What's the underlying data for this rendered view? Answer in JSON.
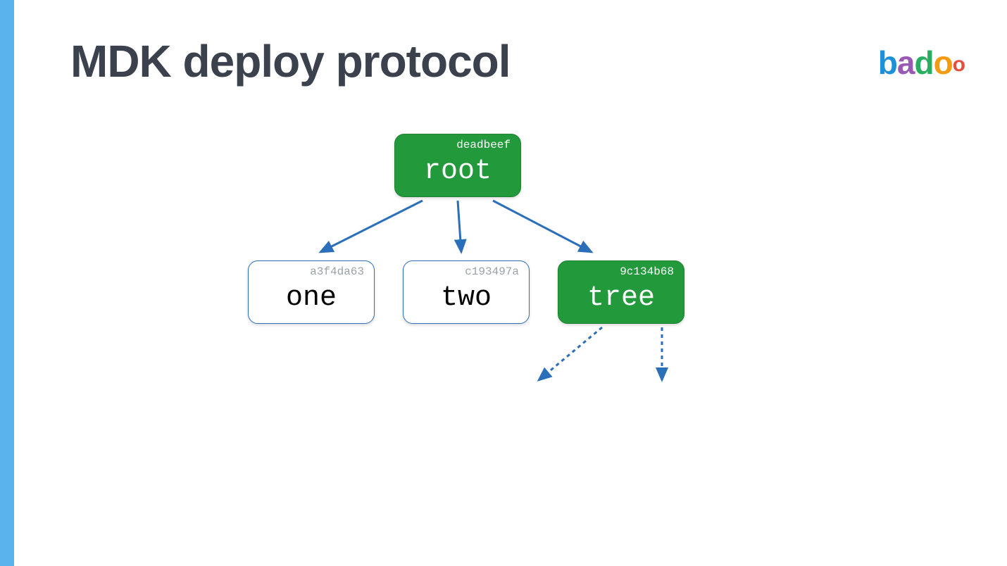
{
  "title": "MDK deploy protocol",
  "logo": {
    "b": "b",
    "a": "a",
    "d": "d",
    "o1": "o",
    "o2": "o"
  },
  "nodes": {
    "root": {
      "hash": "deadbeef",
      "label": "root"
    },
    "one": {
      "hash": "a3f4da63",
      "label": "one"
    },
    "two": {
      "hash": "c193497a",
      "label": "two"
    },
    "tree": {
      "hash": "9c134b68",
      "label": "tree"
    }
  },
  "colors": {
    "green": "#22993a",
    "arrow": "#2b6fbb",
    "title": "#3b424d"
  }
}
